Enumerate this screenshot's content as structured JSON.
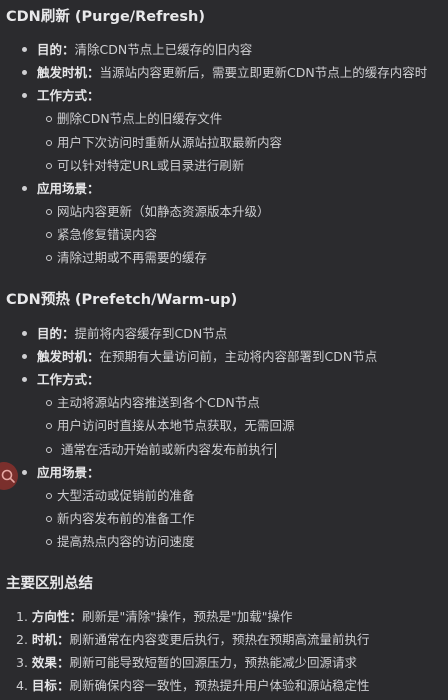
{
  "section1": {
    "title": "CDN刷新 (Purge/Refresh)",
    "items": [
      {
        "label": "目的",
        "text": "清除CDN节点上已缓存的旧内容"
      },
      {
        "label": "触发时机",
        "text": "当源站内容更新后，需要立即更新CDN节点上的缓存内容时"
      },
      {
        "label": "工作方式",
        "text": "",
        "sub": [
          "删除CDN节点上的旧缓存文件",
          "用户下次访问时重新从源站拉取最新内容",
          "可以针对特定URL或目录进行刷新"
        ]
      },
      {
        "label": "应用场景",
        "text": "",
        "sub": [
          "网站内容更新（如静态资源版本升级）",
          "紧急修复错误内容",
          "清除过期或不再需要的缓存"
        ]
      }
    ]
  },
  "section2": {
    "title": "CDN预热 (Prefetch/Warm-up)",
    "items": [
      {
        "label": "目的",
        "text": "提前将内容缓存到CDN节点"
      },
      {
        "label": "触发时机",
        "text": "在预期有大量访问前，主动将内容部署到CDN节点"
      },
      {
        "label": "工作方式",
        "text": "",
        "sub": [
          "主动将源站内容推送到各个CDN节点",
          "用户访问时直接从本地节点获取，无需回源",
          "通常在活动开始前或新内容发布前执行"
        ]
      },
      {
        "label": "应用场景",
        "text": "",
        "sub": [
          "大型活动或促销前的准备",
          "新内容发布前的准备工作",
          "提高热点内容的访问速度"
        ]
      }
    ]
  },
  "section3": {
    "title": "主要区别总结",
    "items": [
      {
        "num": "1.",
        "label": "方向性",
        "text": "刷新是\"清除\"操作，预热是\"加载\"操作"
      },
      {
        "num": "2.",
        "label": "时机",
        "text": "刷新通常在内容变更后执行，预热在预期高流量前执行"
      },
      {
        "num": "3.",
        "label": "效果",
        "text": "刷新可能导致短暂的回源压力，预热能减少回源请求"
      },
      {
        "num": "4.",
        "label": "目标",
        "text": "刷新确保内容一致性，预热提升用户体验和源站稳定性"
      }
    ]
  },
  "colon": "：",
  "icons": {
    "fab": "search-icon"
  },
  "colors": {
    "background": "#2b2b2e",
    "text": "#cfcfd2",
    "fab": "#7a2f2c"
  }
}
